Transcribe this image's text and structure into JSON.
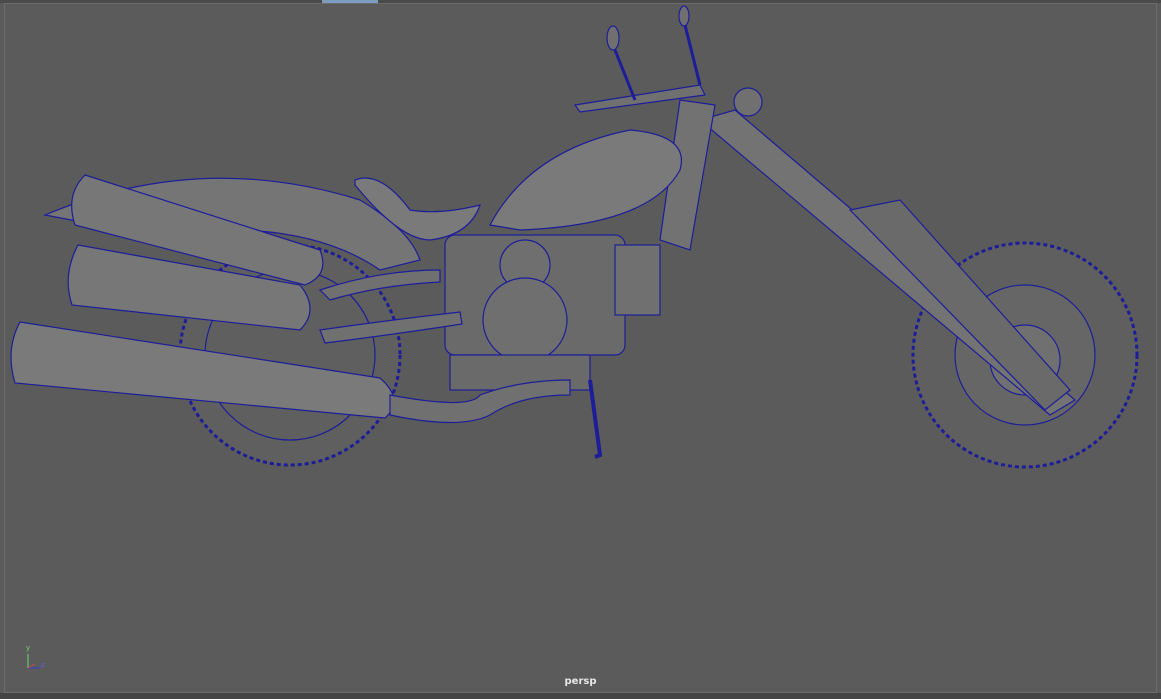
{
  "viewport": {
    "camera_label": "persp",
    "axis_labels": {
      "y": "y",
      "z": "z"
    },
    "wire_color": "#1a1aa0",
    "shade_color": "#6e6e6e",
    "background_color": "#5b5b5b"
  }
}
